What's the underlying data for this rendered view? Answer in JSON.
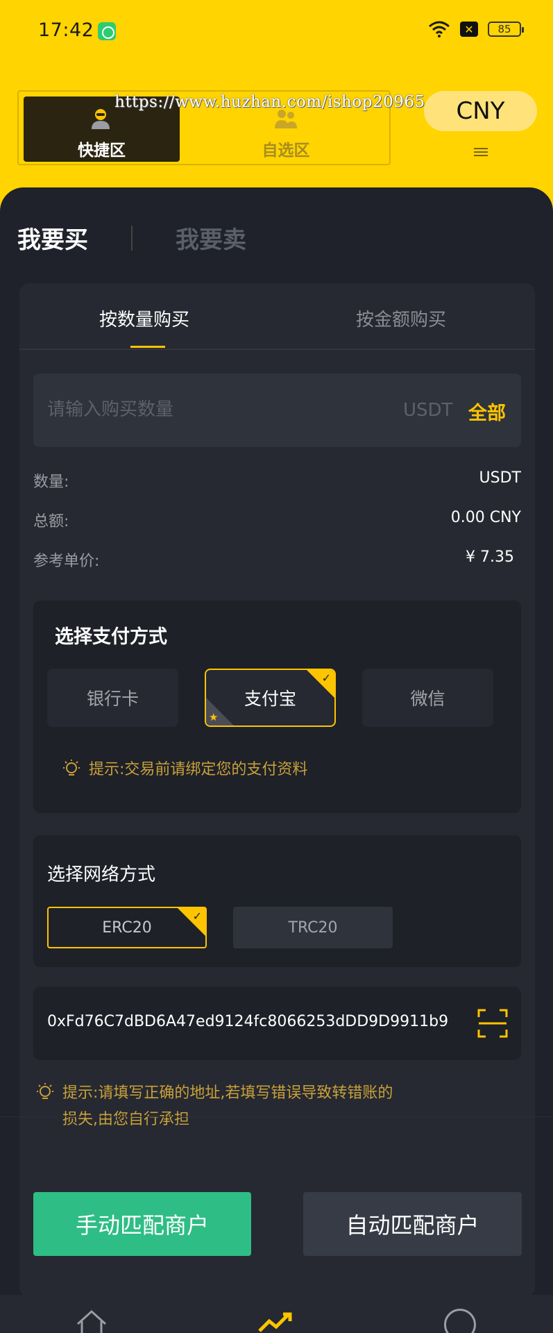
{
  "status_bar": {
    "time": "17:42",
    "battery": "85"
  },
  "zones": {
    "quick_label": "快捷区",
    "custom_label": "自选区"
  },
  "watermark": "https://www.huzhan.com/ishop20965",
  "currency": "CNY",
  "trade_tabs": {
    "buy": "我要买",
    "sell": "我要卖"
  },
  "sub_tabs": {
    "by_quantity": "按数量购买",
    "by_amount": "按金额购买"
  },
  "quantity_input": {
    "value": "",
    "placeholder": "请输入购买数量",
    "unit": "USDT",
    "all_label": "全部"
  },
  "summary": {
    "quantity_label": "数量:",
    "quantity_value": "USDT",
    "total_label": "总额:",
    "total_value": "0.00 CNY",
    "price_label": "参考单价:",
    "price_value": "¥  7.35"
  },
  "payment": {
    "title": "选择支付方式",
    "options": [
      "银行卡",
      "支付宝",
      "微信"
    ],
    "selected": "支付宝",
    "tip": "提示:交易前请绑定您的支付资料"
  },
  "network": {
    "title": "选择网络方式",
    "options": [
      "ERC20",
      "TRC20"
    ],
    "selected": "ERC20"
  },
  "address": {
    "value": "0xFd76C7dBD6A47ed9124fc8066253dDD9D9911b9"
  },
  "address_tip": {
    "line1": "提示:请填写正确的地址,若填写错误导致转错账的",
    "line2": "损失,由您自行承担"
  },
  "actions": {
    "manual": "手动匹配商户",
    "auto": "自动匹配商户"
  },
  "colors": {
    "accent": "#ffc400",
    "header_bg": "#ffd400",
    "primary_button": "#2ebd85",
    "page_bg": "#1f222a"
  },
  "icons": [
    "wifi-icon",
    "close-box-icon",
    "battery-icon",
    "robot-user-icon",
    "users-icon",
    "menu-icon",
    "bulb-icon",
    "check-icon",
    "star-icon",
    "scan-icon",
    "home-icon",
    "market-icon",
    "circle-icon"
  ]
}
